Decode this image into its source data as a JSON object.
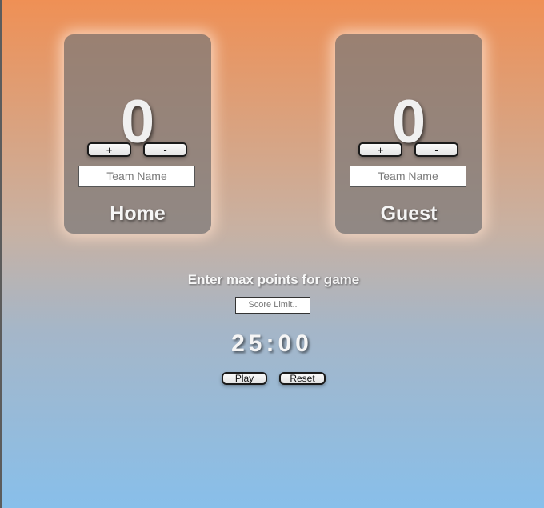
{
  "home": {
    "score": "0",
    "increment_label": "+",
    "decrement_label": "-",
    "team_name_placeholder": "Team Name",
    "label": "Home"
  },
  "guest": {
    "score": "0",
    "increment_label": "+",
    "decrement_label": "-",
    "team_name_placeholder": "Team Name",
    "label": "Guest"
  },
  "game": {
    "prompt": "Enter max points for game",
    "score_limit_placeholder": "Score Limit..",
    "timer": "25:00",
    "play_label": "Play",
    "reset_label": "Reset"
  },
  "colors": {
    "background_top": "#ef9055",
    "background_bottom": "#88bfea",
    "card": "#8a807a"
  }
}
